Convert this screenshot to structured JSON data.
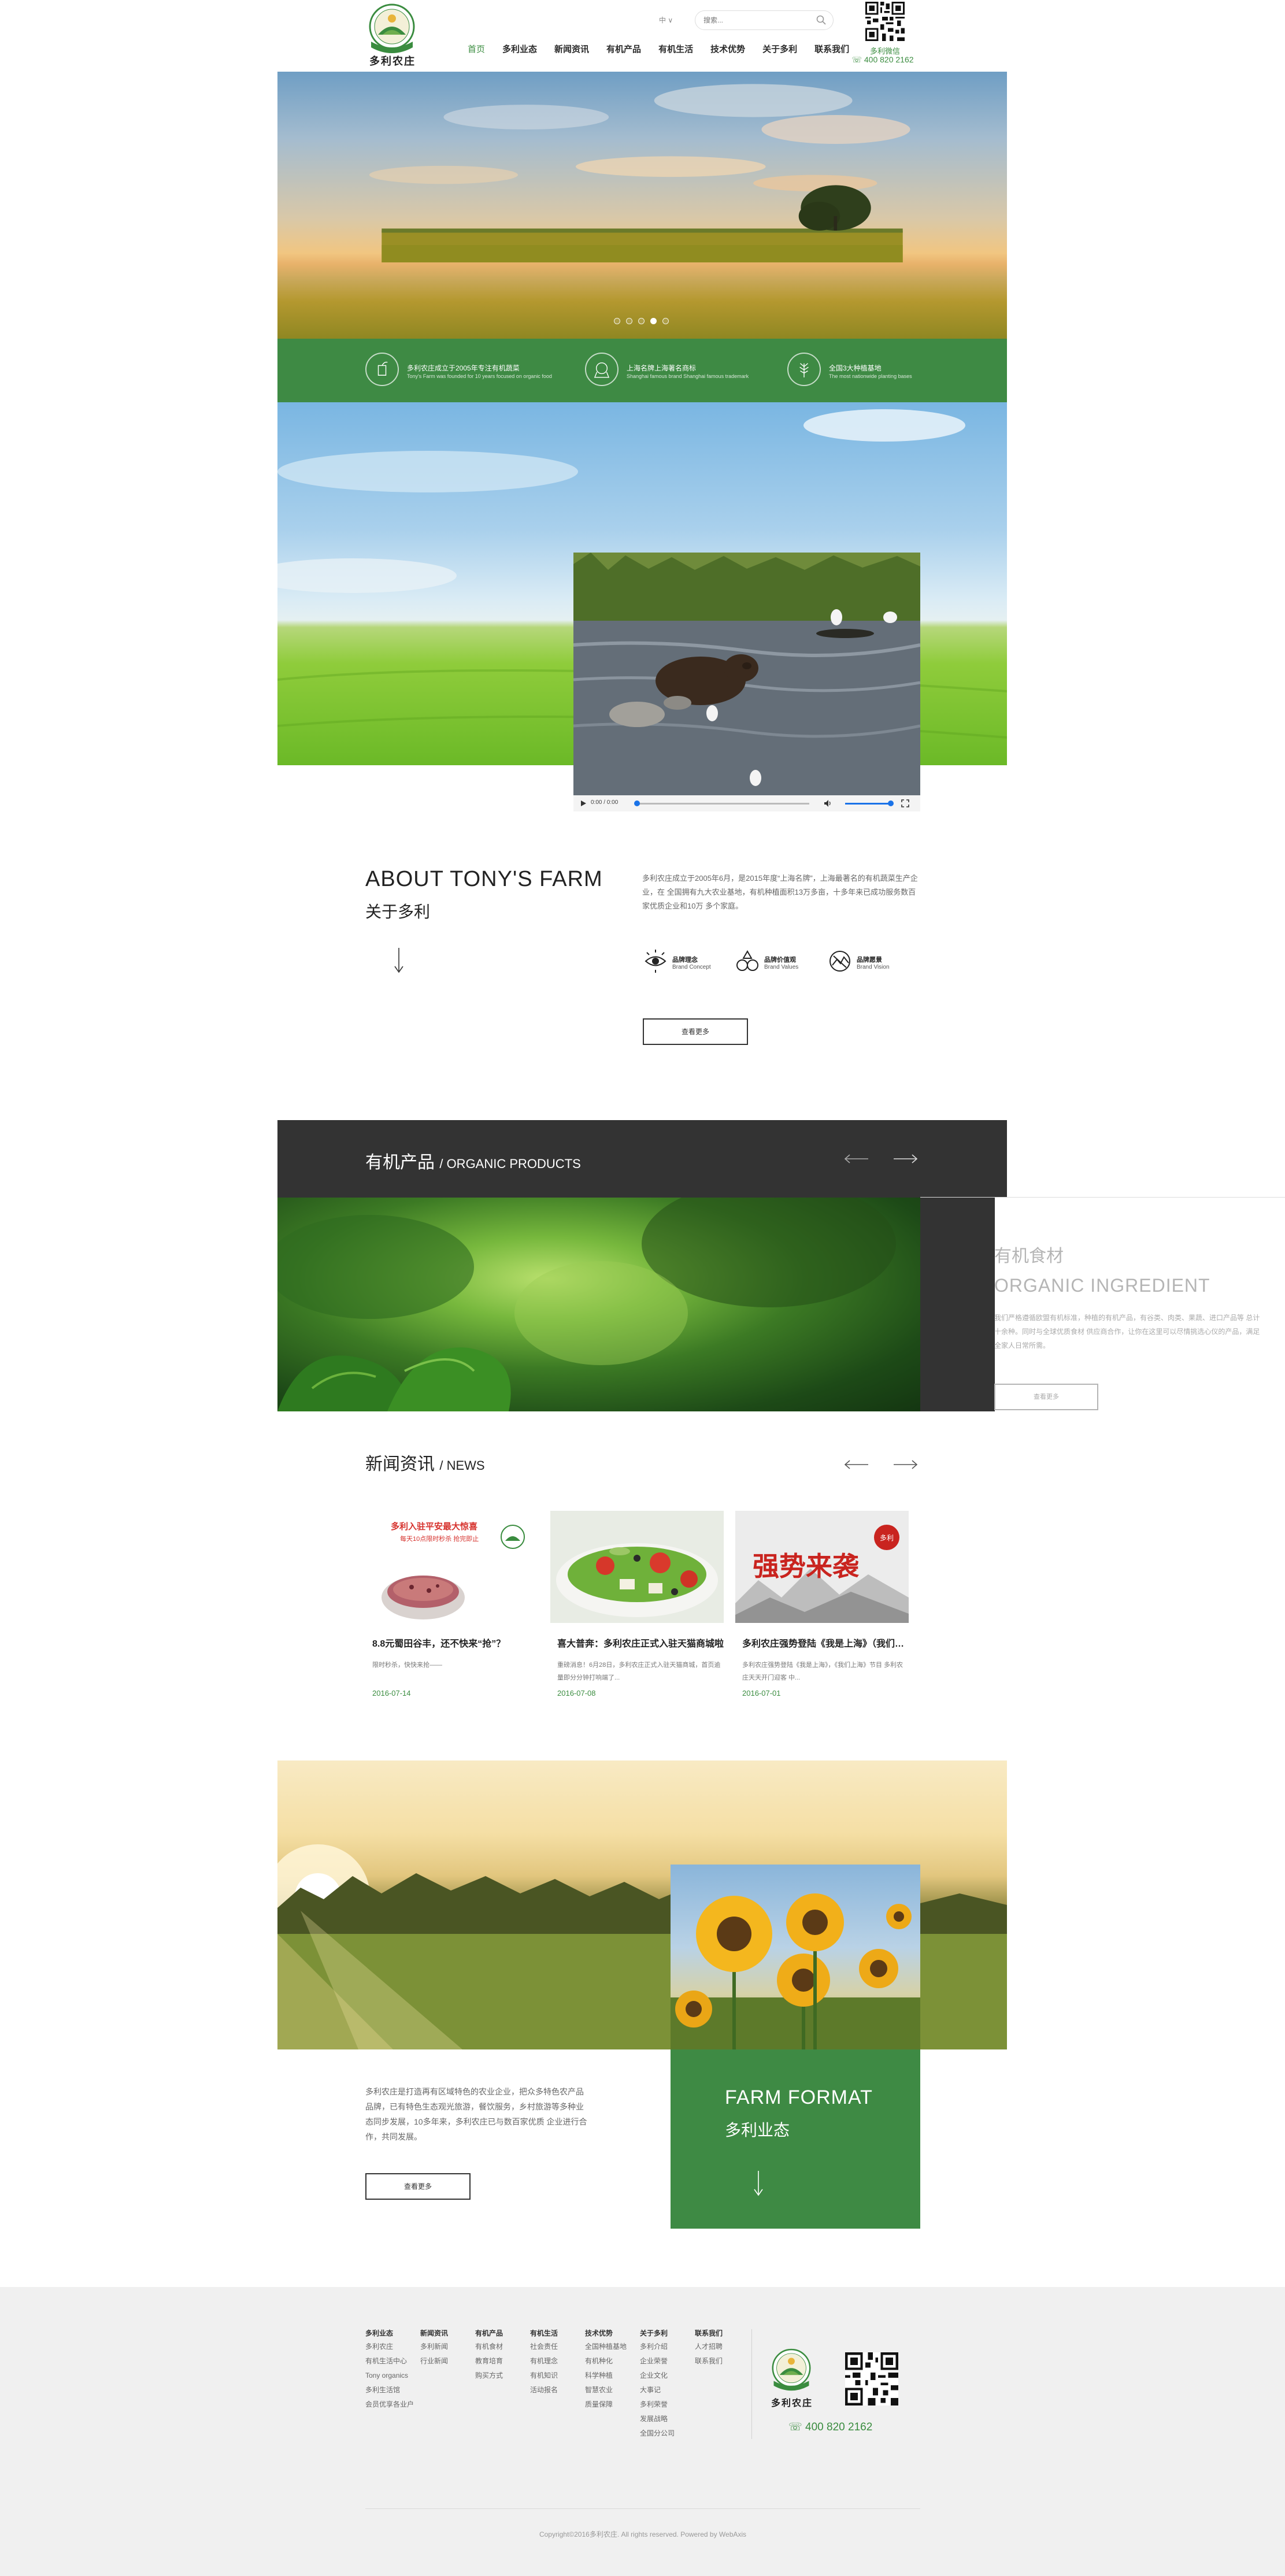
{
  "brand": {
    "name": "多利农庄",
    "logo_ring_text": "TONY'S FARM"
  },
  "header": {
    "lang": "中 ∨",
    "search_placeholder": "搜索...",
    "nav": [
      "首页",
      "多利业态",
      "新闻资讯",
      "有机产品",
      "有机生活",
      "技术优势",
      "关于多利",
      "联系我们"
    ],
    "wechat_label": "多利微信",
    "phone": "400 820 2162"
  },
  "hero": {
    "slides": 5,
    "active_slide": 4
  },
  "features": [
    {
      "title": "多利农庄成立于2005年专注有机蔬菜",
      "sub": "Tony's Farm was founded for 10 years focused on organic food"
    },
    {
      "title": "上海名牌上海著名商标",
      "sub": "Shanghai famous brand Shanghai famous trademark"
    },
    {
      "title": "全国3大种植基地",
      "sub": "The most nationwide planting bases"
    }
  ],
  "video": {
    "time": "0:00 / 0:00",
    "progress": 0,
    "volume": 1
  },
  "about": {
    "title_en": "ABOUT TONY'S FARM",
    "title_zh": "关于多利",
    "text": "多利农庄成立于2005年6月，是2015年度“上海名牌”，上海最著名的有机蔬菜生产企业，在 全国拥有九大农业基地，有机种植面积13万多亩，十多年来已成功服务数百家优质企业和10万 多个家庭。",
    "brand_items": [
      {
        "zh": "品牌理念",
        "en": "Brand Concept",
        "icon": "eye-icon"
      },
      {
        "zh": "品牌价值观",
        "en": "Brand Values",
        "icon": "values-icon"
      },
      {
        "zh": "品牌愿景",
        "en": "Brand Vision",
        "icon": "vision-icon"
      }
    ],
    "more": "查看更多"
  },
  "products": {
    "title": "有机产品",
    "title_en": "/ ORGANIC PRODUCTS",
    "panel_zh": "有机食材",
    "panel_en": "ORGANIC INGREDIENT",
    "desc": "我们严格遵循欧盟有机标准，种植的有机产品，有谷类、肉类、果蔬、进口产品等 总计十余种。同时与全球优质食材 供应商合作，让你在这里可以尽情挑选心仪的产品，满足全家人日常所需。",
    "more": "查看更多"
  },
  "news": {
    "title": "新闻资讯",
    "title_en": "/ NEWS",
    "items": [
      {
        "headline": "8.8元蜀田谷丰，还不快来“抢”？",
        "summary": "限时秒杀，快快来抢——",
        "date": "2016-07-14",
        "img_text_1": "多利入驻平安最大惊喜",
        "img_text_2": "每天10点限时秒杀 抢完即止"
      },
      {
        "headline": "喜大普奔：多利农庄正式入驻天猫商城啦",
        "summary": "重磅消息！6月28日，多利农庄正式入驻天猫商城，首页逾量即分分钟打响端了...",
        "date": "2016-07-08",
        "img_text_1": "",
        "img_text_2": ""
      },
      {
        "headline": "多利农庄强势登陆《我是上海》（我们上海）",
        "summary": "多利农庄强势登陆《我是上海》，《我们上海》节目 多利农庄天天开门迎客 中...",
        "date": "2016-07-01",
        "img_text_1": "强势来袭",
        "img_text_2": "多利"
      }
    ]
  },
  "farm": {
    "title_en": "FARM FORMAT",
    "title_zh": "多利业态",
    "text": "多利农庄是打造再有区域特色的农业企业，把众多特色农产品品牌，已有特色生态观光旅游，餐饮服务，乡村旅游等多种业态同步发展，10多年来，多利农庄已与数百家优质 企业进行合作，共同发展。",
    "more": "查看更多"
  },
  "footer": {
    "columns": [
      {
        "title": "多利业态",
        "links": [
          "多利农庄",
          "有机生活中心",
          "Tony organics",
          "多利生活馆",
          "会员优享各业户"
        ]
      },
      {
        "title": "新闻资讯",
        "links": [
          "多利新闻",
          "行业新闻"
        ]
      },
      {
        "title": "有机产品",
        "links": [
          "有机食材",
          "教育培育",
          "购买方式"
        ]
      },
      {
        "title": "有机生活",
        "links": [
          "社会责任",
          "有机理念",
          "有机知识",
          "活动报名"
        ]
      },
      {
        "title": "技术优势",
        "links": [
          "全国种植基地",
          "有机种化",
          "科学种植",
          "智慧农业",
          "质量保障"
        ]
      },
      {
        "title": "关于多利",
        "links": [
          "多利介绍",
          "企业荣誉",
          "企业文化",
          "大事记",
          "多利荣誉",
          "发展战略",
          "全国分公司"
        ]
      },
      {
        "title": "联系我们",
        "links": [
          "人才招聘",
          "联系我们"
        ]
      }
    ],
    "phone": "400 820 2162",
    "copyright": "Copyright©2016多利农庄. All rights reserved. Powered by WebAxis"
  },
  "colors": {
    "accent_green": "#3e8a44",
    "dark_band": "#333333",
    "footer_bg": "#f0f0f0"
  }
}
